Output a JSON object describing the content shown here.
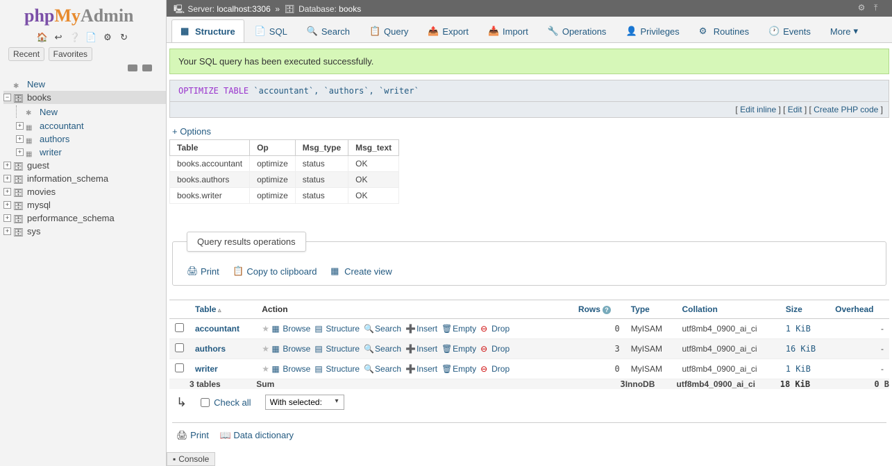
{
  "logo": {
    "php": "php",
    "my": "My",
    "admin": "Admin"
  },
  "recent": {
    "recent": "Recent",
    "favorites": "Favorites"
  },
  "nav": {
    "new": "New",
    "databases": [
      {
        "name": "books",
        "expanded": true,
        "selected": true,
        "tables": [
          "accountant",
          "authors",
          "writer"
        ]
      },
      {
        "name": "guest"
      },
      {
        "name": "information_schema"
      },
      {
        "name": "movies"
      },
      {
        "name": "mysql"
      },
      {
        "name": "performance_schema"
      },
      {
        "name": "sys"
      }
    ]
  },
  "breadcrumb": {
    "server_label": "Server:",
    "server": "localhost:3306",
    "db_label": "Database:",
    "db": "books"
  },
  "tabs": [
    {
      "label": "Structure",
      "active": true
    },
    {
      "label": "SQL"
    },
    {
      "label": "Search"
    },
    {
      "label": "Query"
    },
    {
      "label": "Export"
    },
    {
      "label": "Import"
    },
    {
      "label": "Operations"
    },
    {
      "label": "Privileges"
    },
    {
      "label": "Routines"
    },
    {
      "label": "Events"
    },
    {
      "label": "More",
      "more": true
    }
  ],
  "success_msg": "Your SQL query has been executed successfully.",
  "sql": {
    "kw1": "OPTIMIZE",
    "kw2": "TABLE",
    "args": "`accountant`, `authors`, `writer`"
  },
  "sql_links": {
    "edit_inline": "Edit inline",
    "edit": "Edit",
    "create_php": "Create PHP code"
  },
  "options_link": "+ Options",
  "result_headers": [
    "Table",
    "Op",
    "Msg_type",
    "Msg_text"
  ],
  "result_rows": [
    [
      "books.accountant",
      "optimize",
      "status",
      "OK"
    ],
    [
      "books.authors",
      "optimize",
      "status",
      "OK"
    ],
    [
      "books.writer",
      "optimize",
      "status",
      "OK"
    ]
  ],
  "ops_title": "Query results operations",
  "ops_links": {
    "print": "Print",
    "copy": "Copy to clipboard",
    "create_view": "Create view"
  },
  "table_headers": {
    "table": "Table",
    "action": "Action",
    "rows": "Rows",
    "type": "Type",
    "collation": "Collation",
    "size": "Size",
    "overhead": "Overhead"
  },
  "actions": {
    "browse": "Browse",
    "structure": "Structure",
    "search": "Search",
    "insert": "Insert",
    "empty": "Empty",
    "drop": "Drop"
  },
  "tables": [
    {
      "name": "accountant",
      "rows": "0",
      "type": "MyISAM",
      "collation": "utf8mb4_0900_ai_ci",
      "size": "1 KiB",
      "overhead": "-"
    },
    {
      "name": "authors",
      "rows": "3",
      "type": "MyISAM",
      "collation": "utf8mb4_0900_ai_ci",
      "size": "16 KiB",
      "overhead": "-"
    },
    {
      "name": "writer",
      "rows": "0",
      "type": "MyISAM",
      "collation": "utf8mb4_0900_ai_ci",
      "size": "1 KiB",
      "overhead": "-"
    }
  ],
  "sum": {
    "label": "3 tables",
    "sum": "Sum",
    "rows": "3",
    "type": "InnoDB",
    "collation": "utf8mb4_0900_ai_ci",
    "size": "18 KiB",
    "overhead": "0 B"
  },
  "checkall": {
    "label": "Check all",
    "with_selected": "With selected:"
  },
  "bottom": {
    "print": "Print",
    "dict": "Data dictionary"
  },
  "console": "Console"
}
